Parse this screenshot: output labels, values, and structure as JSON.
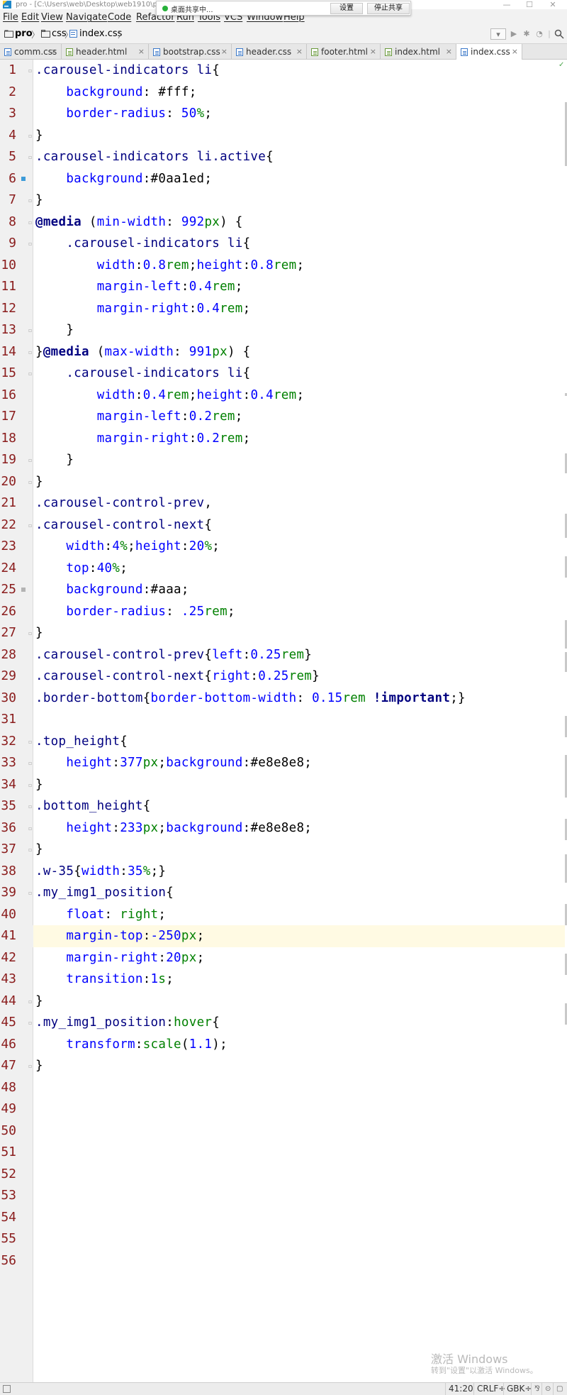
{
  "window": {
    "title": "pro - [C:\\Users\\web\\Desktop\\web1910\\pro",
    "controls": {
      "minimize": "—",
      "maximize": "☐",
      "close": "✕"
    }
  },
  "share_bar": {
    "status": "桌面共享中...",
    "settings_button": "设置",
    "stop_button": "停止共享"
  },
  "menu": {
    "items": [
      "File",
      "Edit",
      "View",
      "Navigate",
      "Code",
      "Refactor",
      "Run",
      "Tools",
      "VCS",
      "Window",
      "Help"
    ]
  },
  "breadcrumb": {
    "items": [
      "pro",
      "css",
      "index.css"
    ],
    "separator": "〉"
  },
  "tabs": [
    {
      "label": "comm.css",
      "type": "css"
    },
    {
      "label": "header.html",
      "type": "html"
    },
    {
      "label": "bootstrap.css",
      "type": "css"
    },
    {
      "label": "header.css",
      "type": "css"
    },
    {
      "label": "footer.html",
      "type": "html"
    },
    {
      "label": "index.html",
      "type": "html"
    },
    {
      "label": "index.css",
      "type": "css",
      "active": true
    }
  ],
  "tab_close_glyph": "×",
  "editor": {
    "current_line": 41,
    "lines": [
      ".carousel-indicators li{",
      "    background: #fff;",
      "    border-radius: 50%;",
      "}",
      ".carousel-indicators li.active{",
      "    background:#0aa1ed;",
      "}",
      "@media (min-width: 992px) {",
      "    .carousel-indicators li{",
      "        width:0.8rem;height:0.8rem;",
      "        margin-left:0.4rem;",
      "        margin-right:0.4rem;",
      "    }",
      "}@media (max-width: 991px) {",
      "    .carousel-indicators li{",
      "        width:0.4rem;height:0.4rem;",
      "        margin-left:0.2rem;",
      "        margin-right:0.2rem;",
      "    }",
      "}",
      ".carousel-control-prev,",
      ".carousel-control-next{",
      "    width:4%;height:20%;",
      "    top:40%;",
      "    background:#aaa;",
      "    border-radius: .25rem;",
      "}",
      ".carousel-control-prev{left:0.25rem}",
      ".carousel-control-next{right:0.25rem}",
      ".border-bottom{border-bottom-width: 0.15rem !important;}",
      "",
      ".top_height{",
      "    height:377px;background:#e8e8e8;",
      "}",
      ".bottom_height{",
      "    height:233px;background:#e8e8e8;",
      "}",
      ".w-35{width:35%;}",
      ".my_img1_position{",
      "    float: right;",
      "    margin-top:-250px;",
      "    margin-right:20px;",
      "    transition:1s;",
      "}",
      ".my_img1_position:hover{",
      "    transform:scale(1.1);",
      "}",
      "",
      "",
      "",
      "",
      "",
      "",
      "",
      "",
      ""
    ],
    "gutter_marks": {
      "6": "blue",
      "25": "grey"
    }
  },
  "watermark": {
    "line1": "激活 Windows",
    "line2": "转到\"设置\"以激活 Windows。"
  },
  "status": {
    "position": "41:20",
    "line_separator": "CRLF÷",
    "encoding": "GBK÷"
  },
  "colors": {
    "selector": "#000080",
    "property": "#0000ff",
    "unit": "#008000",
    "line_number": "#8a1c1c",
    "current_line_bg": "#fffae3"
  }
}
